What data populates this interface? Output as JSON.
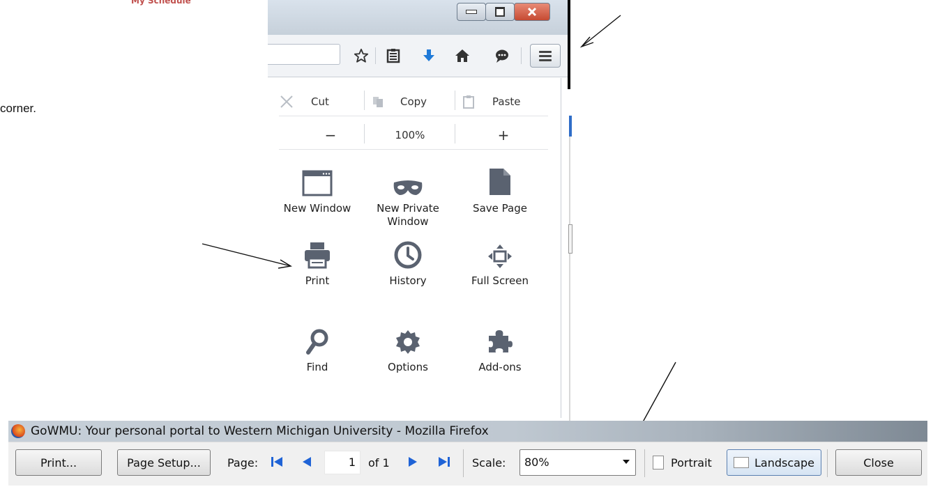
{
  "page": {
    "side_text": "corner.",
    "brand_text": "My Schedule"
  },
  "toolbar": {
    "icons": [
      "bookmark-star-icon",
      "reading-list-icon",
      "downloads-icon",
      "home-icon",
      "chat-icon"
    ],
    "menu_button": "open-menu"
  },
  "menu": {
    "edit_row": {
      "cut": "Cut",
      "copy": "Copy",
      "paste": "Paste"
    },
    "zoom_row": {
      "zoom_out": "−",
      "zoom_level": "100%",
      "zoom_in": "+"
    },
    "items": [
      {
        "label": "New Window",
        "icon": "new-window-icon"
      },
      {
        "label": "New Private Window",
        "icon": "private-mask-icon"
      },
      {
        "label": "Save Page",
        "icon": "save-page-icon"
      },
      {
        "label": "Print",
        "icon": "printer-icon"
      },
      {
        "label": "History",
        "icon": "history-clock-icon"
      },
      {
        "label": "Full Screen",
        "icon": "fullscreen-icon"
      },
      {
        "label": "Find",
        "icon": "magnifier-icon"
      },
      {
        "label": "Options",
        "icon": "gear-icon"
      },
      {
        "label": "Add-ons",
        "icon": "puzzle-piece-icon"
      }
    ]
  },
  "print_preview": {
    "window_title": "GoWMU: Your personal portal to Western Michigan University - Mozilla Firefox",
    "print_btn": "Print...",
    "page_setup_btn": "Page Setup...",
    "page_label": "Page:",
    "page_value": "1",
    "of_label": "of 1",
    "scale_label": "Scale:",
    "scale_value": "80%",
    "portrait": "Portrait",
    "landscape": "Landscape",
    "close": "Close"
  },
  "colors": {
    "accent_blue": "#1f7ad8",
    "icon_gray": "#4b5563",
    "nav_blue": "#1f63d6"
  }
}
